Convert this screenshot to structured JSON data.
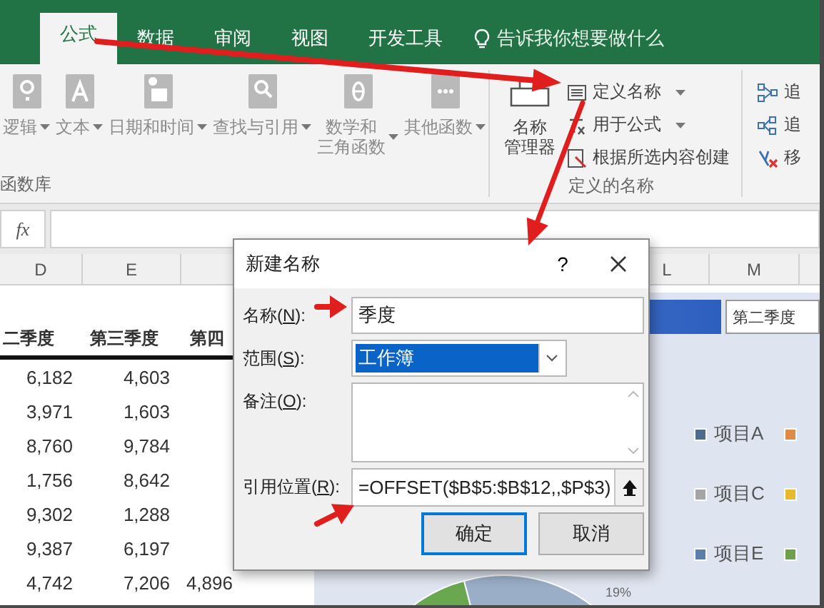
{
  "ribbon_tabs": [
    {
      "label": "公式",
      "selected": true
    },
    {
      "label": "数据",
      "selected": false
    },
    {
      "label": "审阅",
      "selected": false
    },
    {
      "label": "视图",
      "selected": false
    },
    {
      "label": "开发工具",
      "selected": false
    }
  ],
  "tell_me": {
    "placeholder": "告诉我你想要做什么"
  },
  "ribbon_groups": [
    {
      "kind": "library",
      "title": "函数库",
      "buttons": [
        {
          "label": "逻辑",
          "disabled": true,
          "dropdown": true
        },
        {
          "label": "文本",
          "disabled": true,
          "dropdown": true
        },
        {
          "label": "日期和时间",
          "disabled": true,
          "dropdown": true
        },
        {
          "label": "查找与引用",
          "disabled": true,
          "dropdown": true
        },
        {
          "label": [
            "数学和",
            "三角函数"
          ],
          "disabled": true,
          "dropdown": true
        },
        {
          "label": "其他函数",
          "disabled": true,
          "dropdown": true
        }
      ]
    },
    {
      "kind": "names",
      "title": "定义的名称",
      "large_button": {
        "label": [
          "名称",
          "管理器"
        ],
        "disabled": false
      },
      "buttons": [
        {
          "label": "定义名称",
          "disabled": false,
          "dropdown": true
        },
        {
          "label": "用于公式",
          "disabled": false,
          "dropdown": true
        },
        {
          "label": "根据所选内容创建",
          "disabled": false,
          "dropdown": false
        }
      ]
    },
    {
      "kind": "audit",
      "buttons": [
        {
          "label": "追",
          "disabled": false
        },
        {
          "label": "追",
          "disabled": false
        },
        {
          "label": "移",
          "disabled": false
        }
      ]
    }
  ],
  "formula_bar": {
    "function_button": "fx"
  },
  "column_headers_left": [
    "D",
    "E"
  ],
  "column_headers_right": [
    "L",
    "M"
  ],
  "table": {
    "columns": [
      {
        "heading": "二季度"
      },
      {
        "heading": "第三季度"
      },
      {
        "heading": "第四"
      }
    ],
    "rows": [
      [
        "6,182",
        "4,603"
      ],
      [
        "3,971",
        "1,603"
      ],
      [
        "8,760",
        "9,784"
      ],
      [
        "1,756",
        "8,642"
      ],
      [
        "9,302",
        "1,288"
      ],
      [
        "9,387",
        "6,197"
      ],
      [
        "4,742",
        "7,206",
        "4,896"
      ]
    ]
  },
  "chart": {
    "dropdown": "第二季度",
    "legend": [
      {
        "label": "项目A",
        "color": "#50698f"
      },
      {
        "label": "项目C",
        "color": "#a5a5a5"
      },
      {
        "label": "项目E",
        "color": "#5b7fa8"
      }
    ],
    "legend_cut": [
      {
        "color": "#e08a4a"
      },
      {
        "color": "#e8b92f"
      },
      {
        "color": "#70a04c"
      }
    ],
    "slice_label": "19%"
  },
  "dialog": {
    "title": "新建名称",
    "help": "?",
    "fields": [
      {
        "kind": "text",
        "label": "名称(",
        "access_key": "N",
        "label_end": "):",
        "value": "季度"
      },
      {
        "kind": "select",
        "label": "范围(",
        "access_key": "S",
        "label_end": "):",
        "value": "工作簿"
      },
      {
        "kind": "textarea",
        "label": "备注(",
        "access_key": "O",
        "label_end": "):"
      },
      {
        "kind": "reference",
        "label": "引用位置(",
        "access_key": "R",
        "label_end": "):",
        "value": "=OFFSET($B$5:$B$12,,$P$3)"
      }
    ],
    "buttons": [
      {
        "label": "确定",
        "default": true
      },
      {
        "label": "取消",
        "default": false
      }
    ]
  }
}
